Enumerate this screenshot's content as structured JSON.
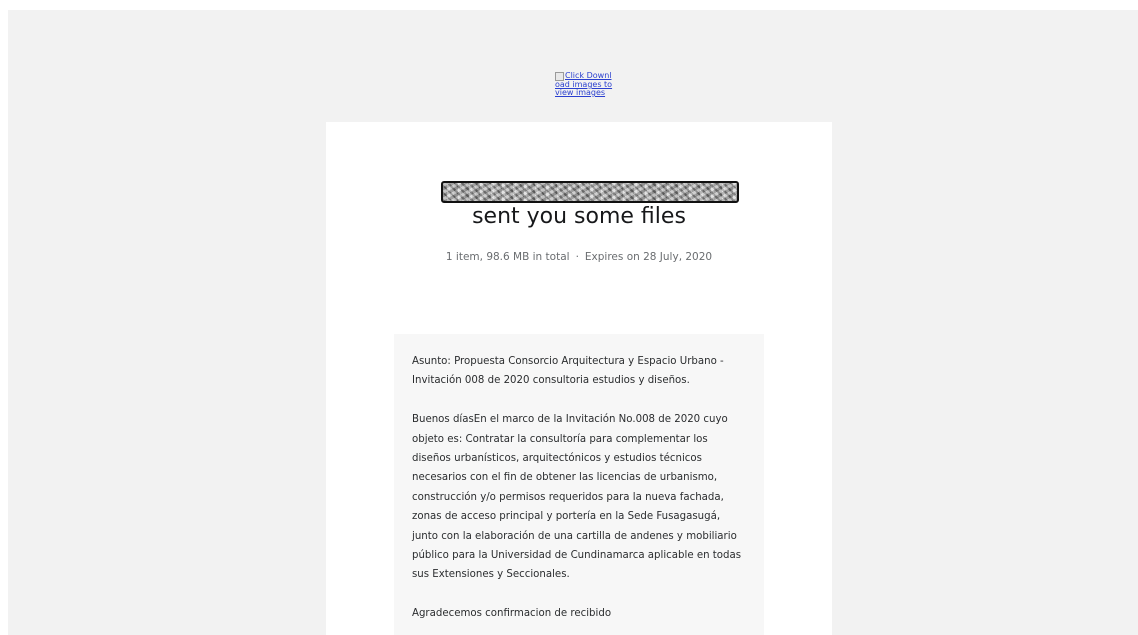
{
  "logo": {
    "alt_text": "Click Download images to view images"
  },
  "header": {
    "headline": "sent you some files",
    "summary": "1 item, 98.6 MB in total",
    "separator": "·",
    "expiry": "Expires on 28 July, 2020"
  },
  "message": {
    "subject": "Asunto: Propuesta Consorcio Arquitectura y Espacio Urbano - Invitación 008 de 2020 consultoria estudios y diseños.",
    "body": "Buenos díasEn el marco de la Invitación No.008 de 2020 cuyo objeto es:  Contratar la consultoría para complementar los diseños urbanísticos, arquitectónicos y estudios técnicos necesarios con el fin de obtener las licencias de urbanismo, construcción y/o permisos requeridos para la nueva fachada, zonas de acceso principal y portería en la Sede Fusagasugá, junto con la elaboración de una cartilla de andenes y mobiliario público para la Universidad de Cundinamarca aplicable en todas sus Extensiones y Seccionales.",
    "closing": "Agradecemos confirmacion de recibido"
  }
}
